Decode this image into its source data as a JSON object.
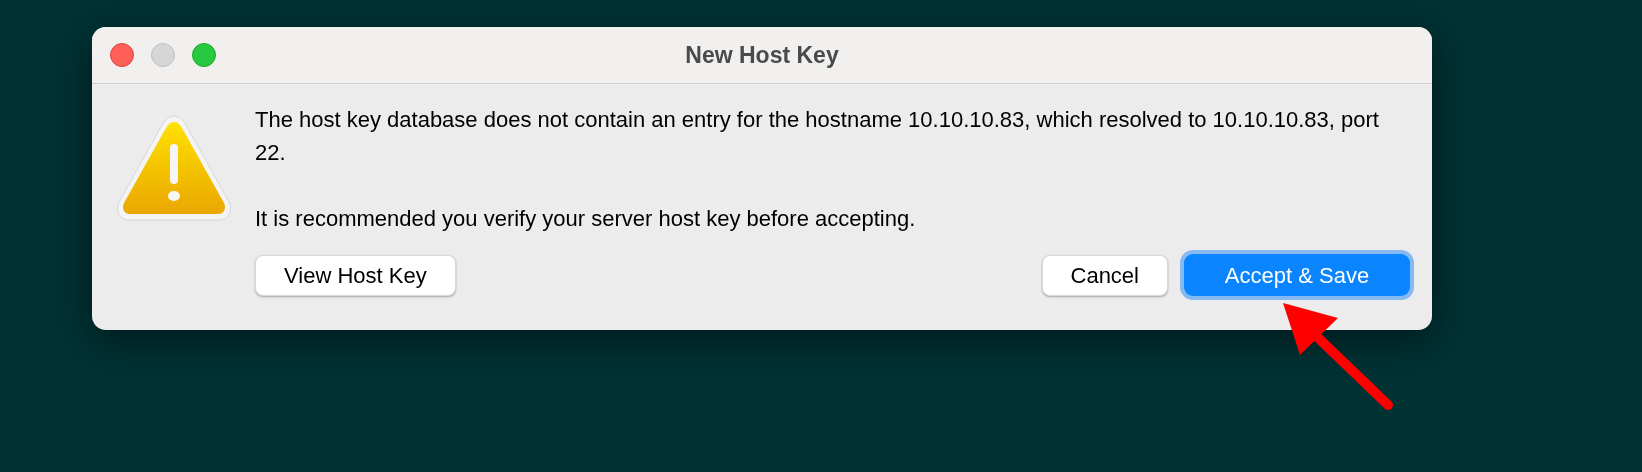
{
  "window": {
    "title": "New Host Key"
  },
  "message": [
    "The host key database does not contain an entry for the hostname 10.10.10.83, which resolved to 10.10.10.83, port 22.",
    "It is recommended you verify your server host key before accepting."
  ],
  "buttons": [
    {
      "label": "View Host Key",
      "kind": "normal"
    },
    {
      "label": "Cancel",
      "kind": "normal"
    },
    {
      "label": "Accept & Save",
      "kind": "default"
    }
  ]
}
